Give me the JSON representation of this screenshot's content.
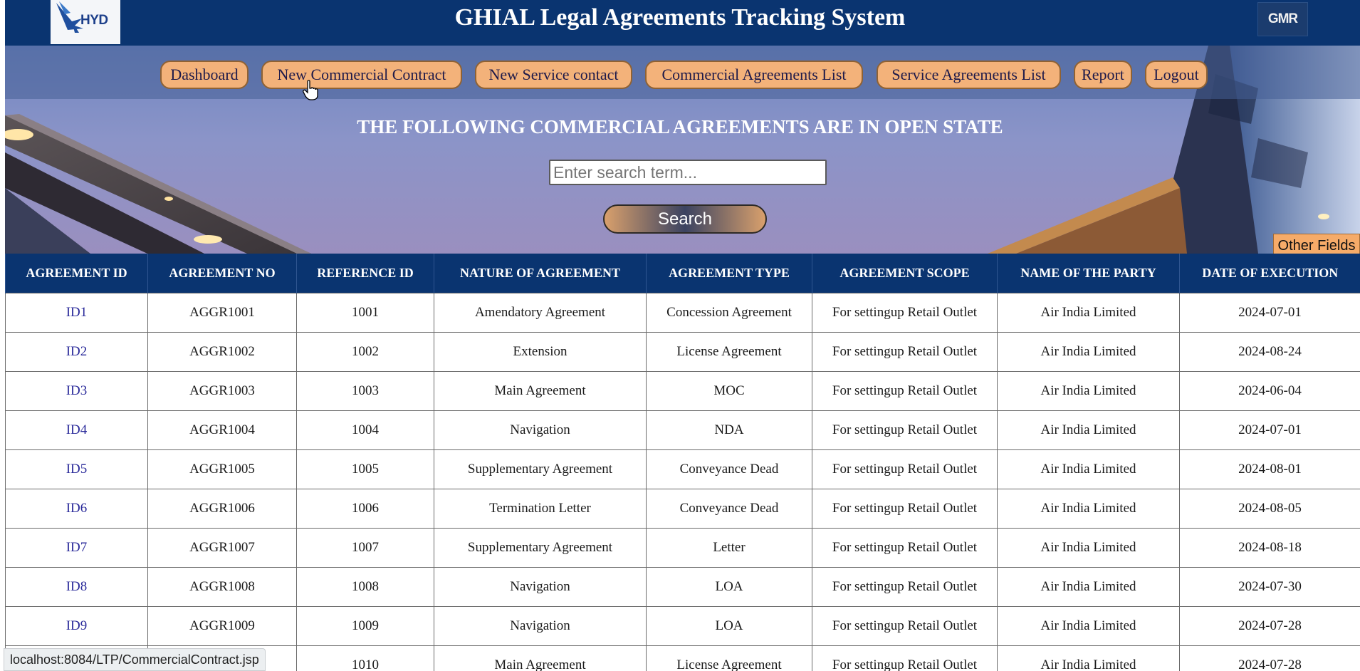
{
  "header": {
    "title": "GHIAL Legal Agreements Tracking System",
    "logo_left_text": "HYD",
    "logo_right_text": "GMR"
  },
  "nav": {
    "items": [
      {
        "label": "Dashboard"
      },
      {
        "label": "New Commercial Contract"
      },
      {
        "label": "New Service contact"
      },
      {
        "label": "Commercial Agreements List"
      },
      {
        "label": "Service Agreements List"
      },
      {
        "label": "Report"
      },
      {
        "label": "Logout"
      }
    ]
  },
  "main": {
    "heading": "THE FOLLOWING COMMERCIAL AGREEMENTS ARE IN OPEN STATE",
    "search_placeholder": "Enter search term...",
    "search_button": "Search",
    "other_fields_button": "Other Fields"
  },
  "table": {
    "columns": [
      "AGREEMENT ID",
      "AGREEMENT NO",
      "REFERENCE ID",
      "NATURE OF AGREEMENT",
      "AGREEMENT TYPE",
      "AGREEMENT SCOPE",
      "NAME OF THE PARTY",
      "DATE OF EXECUTION"
    ],
    "rows": [
      [
        "ID1",
        "AGGR1001",
        "1001",
        "Amendatory Agreement",
        "Concession Agreement",
        "For settingup Retail Outlet",
        "Air India Limited",
        "2024-07-01"
      ],
      [
        "ID2",
        "AGGR1002",
        "1002",
        "Extension",
        "License Agreement",
        "For settingup Retail Outlet",
        "Air India Limited",
        "2024-08-24"
      ],
      [
        "ID3",
        "AGGR1003",
        "1003",
        "Main Agreement",
        "MOC",
        "For settingup Retail Outlet",
        "Air India Limited",
        "2024-06-04"
      ],
      [
        "ID4",
        "AGGR1004",
        "1004",
        "Navigation",
        "NDA",
        "For settingup Retail Outlet",
        "Air India Limited",
        "2024-07-01"
      ],
      [
        "ID5",
        "AGGR1005",
        "1005",
        "Supplementary Agreement",
        "Conveyance Dead",
        "For settingup Retail Outlet",
        "Air India Limited",
        "2024-08-01"
      ],
      [
        "ID6",
        "AGGR1006",
        "1006",
        "Termination Letter",
        "Conveyance Dead",
        "For settingup Retail Outlet",
        "Air India Limited",
        "2024-08-05"
      ],
      [
        "ID7",
        "AGGR1007",
        "1007",
        "Supplementary Agreement",
        "Letter",
        "For settingup Retail Outlet",
        "Air India Limited",
        "2024-08-18"
      ],
      [
        "ID8",
        "AGGR1008",
        "1008",
        "Navigation",
        "LOA",
        "For settingup Retail Outlet",
        "Air India Limited",
        "2024-07-30"
      ],
      [
        "ID9",
        "AGGR1009",
        "1009",
        "Navigation",
        "LOA",
        "For settingup Retail Outlet",
        "Air India Limited",
        "2024-07-28"
      ],
      [
        "",
        "",
        "1010",
        "Main Agreement",
        "License Agreement",
        "For settingup Retail Outlet",
        "Air India Limited",
        "2024-07-28"
      ]
    ]
  },
  "status_bar": {
    "url": "localhost:8084/LTP/CommercialContract.jsp"
  },
  "colors": {
    "header_bg": "#0a3470",
    "nav_button_bg": "#f3b27a",
    "link_color": "#2a2a9a"
  }
}
